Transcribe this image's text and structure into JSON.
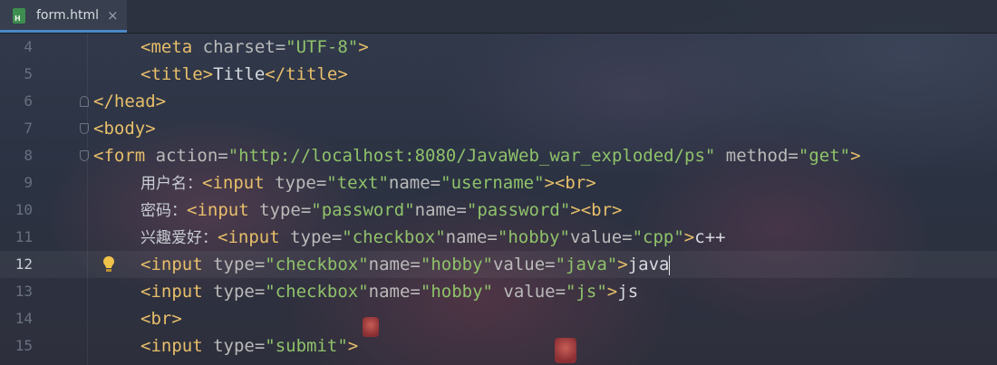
{
  "tab": {
    "filename": "form.html",
    "icon": "html-file-icon",
    "close": "×"
  },
  "current_line": 12,
  "lines": [
    {
      "no": "4",
      "indent": 155,
      "segments": [
        [
          "tag",
          "<meta "
        ],
        [
          "attr",
          "charset="
        ],
        [
          "str",
          "\"UTF-8\""
        ],
        [
          "tag",
          ">"
        ]
      ]
    },
    {
      "no": "5",
      "indent": 155,
      "segments": [
        [
          "tag",
          "<title>"
        ],
        [
          "txt",
          "Title"
        ],
        [
          "tag",
          "</title>"
        ]
      ]
    },
    {
      "no": "6",
      "indent": 103,
      "segments": [
        [
          "tag",
          "</head>"
        ]
      ]
    },
    {
      "no": "7",
      "indent": 103,
      "segments": [
        [
          "tag",
          "<body>"
        ]
      ]
    },
    {
      "no": "8",
      "indent": 103,
      "segments": [
        [
          "tag",
          "<form "
        ],
        [
          "attr",
          "action="
        ],
        [
          "str",
          "\"http://localhost:8080/JavaWeb_war_exploded/ps\""
        ],
        [
          "attr",
          " method="
        ],
        [
          "str",
          "\"get\""
        ],
        [
          "tag",
          ">"
        ]
      ]
    },
    {
      "no": "9",
      "indent": 155,
      "segments": [
        [
          "cjk",
          "用户名："
        ],
        [
          "tag",
          "<input "
        ],
        [
          "attr",
          "type="
        ],
        [
          "str",
          "\"text\""
        ],
        [
          "attr",
          "name="
        ],
        [
          "str",
          "\"username\""
        ],
        [
          "tag",
          "><br>"
        ]
      ]
    },
    {
      "no": "10",
      "indent": 155,
      "segments": [
        [
          "cjk",
          "密码："
        ],
        [
          "tag",
          "<input "
        ],
        [
          "attr",
          "type="
        ],
        [
          "str",
          "\"password\""
        ],
        [
          "attr",
          "name="
        ],
        [
          "str",
          "\"password\""
        ],
        [
          "tag",
          "><br>"
        ]
      ]
    },
    {
      "no": "11",
      "indent": 155,
      "segments": [
        [
          "cjk",
          "兴趣爱好："
        ],
        [
          "tag",
          "<input "
        ],
        [
          "attr",
          "type="
        ],
        [
          "str",
          "\"checkbox\""
        ],
        [
          "attr",
          "name="
        ],
        [
          "str",
          "\"hobby\""
        ],
        [
          "attr",
          "value="
        ],
        [
          "str",
          "\"cpp\""
        ],
        [
          "tag",
          ">"
        ],
        [
          "txt",
          "c++"
        ]
      ]
    },
    {
      "no": "12",
      "indent": 155,
      "segments": [
        [
          "tag",
          "<input "
        ],
        [
          "attr",
          "type="
        ],
        [
          "str",
          "\"checkbox\""
        ],
        [
          "attr",
          "name="
        ],
        [
          "str",
          "\"hobby\""
        ],
        [
          "attr",
          "value="
        ],
        [
          "str",
          "\"java\""
        ],
        [
          "tag",
          ">"
        ],
        [
          "txt",
          "java"
        ]
      ]
    },
    {
      "no": "13",
      "indent": 155,
      "segments": [
        [
          "tag",
          "<input "
        ],
        [
          "attr",
          "type="
        ],
        [
          "str",
          "\"checkbox\""
        ],
        [
          "attr",
          "name="
        ],
        [
          "str",
          "\"hobby\""
        ],
        [
          "attr",
          " value="
        ],
        [
          "str",
          "\"js\""
        ],
        [
          "tag",
          ">"
        ],
        [
          "txt",
          "js"
        ]
      ]
    },
    {
      "no": "14",
      "indent": 155,
      "segments": [
        [
          "tag",
          "<br>"
        ]
      ]
    },
    {
      "no": "15",
      "indent": 155,
      "segments": [
        [
          "tag",
          "<input "
        ],
        [
          "attr",
          "type="
        ],
        [
          "str",
          "\"submit\""
        ],
        [
          "tag",
          ">"
        ]
      ]
    }
  ],
  "colors": {
    "tag": "#e8bf6a",
    "attr": "#bababa",
    "string": "#8fc26a",
    "text": "#d6d9df",
    "caret_tab": "#4a88c7"
  }
}
